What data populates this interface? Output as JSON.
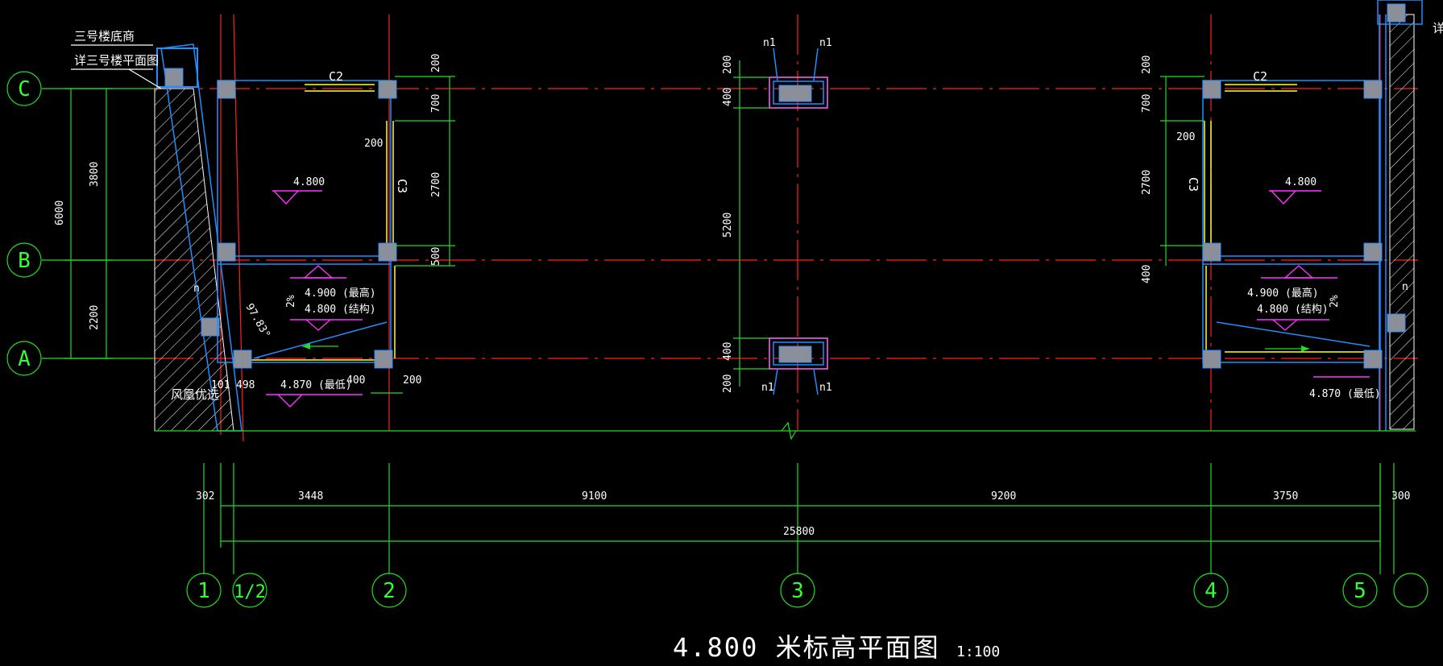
{
  "title": "4.800  米标高平面图",
  "scale": "1:100",
  "axes": {
    "rows": [
      "C",
      "B",
      "A"
    ],
    "cols": [
      "1",
      "1/2",
      "2",
      "3",
      "4",
      "5",
      ""
    ]
  },
  "notes": {
    "note1": "三号楼底商",
    "note2": "详三号楼平面图",
    "note3": "详",
    "wind": "风凰优选"
  },
  "windows": {
    "c2": "C2",
    "c3": "C3",
    "n1": "n1",
    "n": "n"
  },
  "elevations": {
    "room": "4.800",
    "top": "4.900 (最高)",
    "struct": "4.800 (结构)",
    "low": "4.870 (最低)"
  },
  "slope": "2%",
  "angle": "97.83°",
  "dims": {
    "bottom_row": [
      "302",
      "3448",
      "9100",
      "9200",
      "3750",
      "300"
    ],
    "total": "25800",
    "left_outer": "6000",
    "left_inner": [
      "3800",
      "2200"
    ],
    "left_room_v": [
      "200",
      "700",
      "2700",
      "500"
    ],
    "left_room_h": [
      "200",
      "400",
      "200",
      "101",
      "498"
    ],
    "center_v": [
      "200",
      "400",
      "5200",
      "400",
      "200"
    ],
    "right_room_v": [
      "200",
      "700",
      "200",
      "2700",
      "400"
    ]
  }
}
